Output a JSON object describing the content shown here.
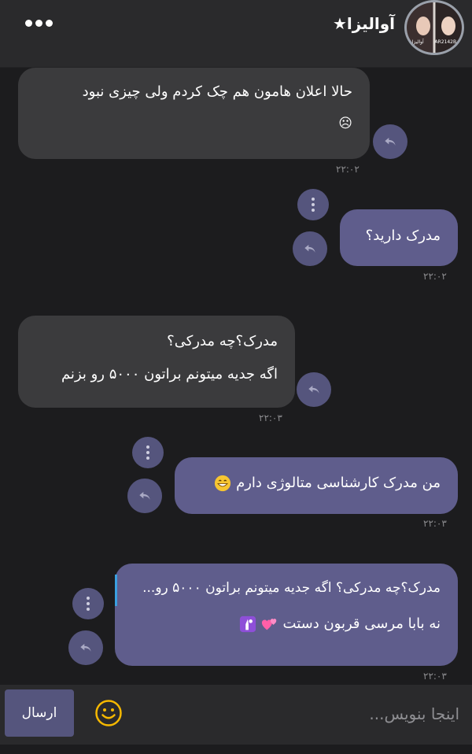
{
  "header": {
    "title": "آوالیزا★",
    "avatar_caption_left": "آوالیزا",
    "avatar_caption_right": "AR2142B"
  },
  "messages": [
    {
      "lines": [
        "حالا اعلان هامون هم چک کردم ولی چیزی نبود",
        "☹"
      ],
      "time": "۲۲:۰۲"
    },
    {
      "lines": [
        "مدرک دارید؟"
      ],
      "time": "۲۲:۰۲"
    },
    {
      "lines": [
        "مدرک؟چه مدرکی؟",
        "اگه جدیه میتونم براتون ۵۰۰۰ رو بزنم"
      ],
      "time": "۲۲:۰۳"
    },
    {
      "lines": [
        "من مدرک کارشناسی متالوژی دارم"
      ],
      "time": "۲۲:۰۳"
    },
    {
      "quote": "مدرک؟چه مدرکی؟ اگه جدیه میتونم براتون ۵۰۰۰ رو...",
      "lines": [
        "نه بابا مرسی قربون دستت"
      ],
      "time": "۲۲:۰۳"
    }
  ],
  "composer": {
    "placeholder": "اینجا بنویس...",
    "value": "",
    "send_label": "ارسال"
  },
  "colors": {
    "incoming_bubble": "#3b3b3d",
    "outgoing_bubble": "#5f5d8c",
    "accent": "#55557d",
    "background": "#1c1c1e"
  },
  "icons": [
    "more-dots-icon",
    "reply-icon",
    "vertical-menu-icon",
    "smiley-emoji-icon",
    "grin-emoji-icon",
    "hearts-emoji-icon",
    "prayer-emoji-icon"
  ]
}
